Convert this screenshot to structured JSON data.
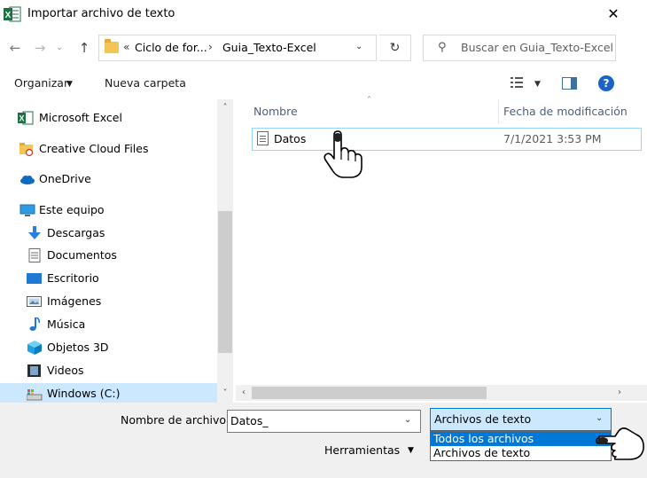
{
  "window": {
    "title": "Importar archivo de texto",
    "close_glyph": "✕"
  },
  "nav": {
    "back_glyph": "←",
    "forward_glyph": "→",
    "recent_glyph": "⌄",
    "up_glyph": "↑"
  },
  "address": {
    "overflow_glyph": "«",
    "crumbs": [
      "Ciclo de for...",
      "Guia_Texto-Excel"
    ],
    "separator": "›",
    "dropdown_glyph": "⌄",
    "refresh_glyph": "↻"
  },
  "search": {
    "icon_glyph": "⚲",
    "placeholder": "Buscar en Guia_Texto-Excel"
  },
  "toolbar": {
    "organize_label": "Organizar",
    "caret_glyph": "▼",
    "new_folder_label": "Nueva carpeta",
    "help_glyph": "?"
  },
  "sidebar": {
    "items": [
      {
        "label": "Microsoft Excel",
        "icon": "excel-icon"
      },
      {
        "label": "Creative Cloud Files",
        "icon": "creative-cloud-folder-icon"
      },
      {
        "label": "OneDrive",
        "icon": "onedrive-cloud-icon"
      },
      {
        "label": "Este equipo",
        "icon": "computer-icon"
      },
      {
        "label": "Descargas",
        "icon": "download-arrow-icon"
      },
      {
        "label": "Documentos",
        "icon": "document-icon"
      },
      {
        "label": "Escritorio",
        "icon": "desktop-icon"
      },
      {
        "label": "Imágenes",
        "icon": "pictures-icon"
      },
      {
        "label": "Música",
        "icon": "music-note-icon"
      },
      {
        "label": "Objetos 3D",
        "icon": "cube-3d-icon"
      },
      {
        "label": "Videos",
        "icon": "video-film-icon"
      },
      {
        "label": "Windows (C:)",
        "icon": "drive-icon"
      }
    ],
    "scroll_up_glyph": "˄",
    "scroll_down_glyph": "˅"
  },
  "filelist": {
    "columns": [
      "Nombre",
      "Fecha de modificación"
    ],
    "sort_glyph": "˄",
    "rows": [
      {
        "name": "Datos",
        "modified": "7/1/2021 3:53 PM"
      }
    ],
    "scroll_left_glyph": "‹",
    "scroll_right_glyph": "›"
  },
  "bottom": {
    "filename_label": "Nombre de archivo:",
    "filename_value": "Datos_",
    "dropdown_glyph": "⌄",
    "file_type_selected": "Archivos de texto",
    "file_type_options": [
      "Todos los archivos",
      "Archivos de texto"
    ],
    "tools_label": "Herramientas"
  },
  "colors": {
    "accent": "#0078d7",
    "selection_light": "#cce8ff",
    "help_blue": "#1a64c8",
    "excel_green": "#1d7044",
    "folder_yellow": "#f2c655"
  }
}
